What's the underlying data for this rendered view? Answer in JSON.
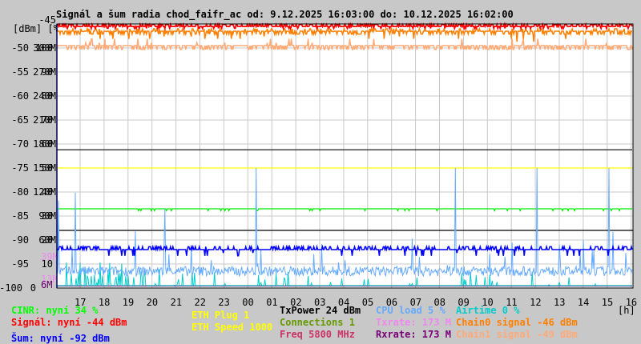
{
  "chart_data": {
    "type": "line",
    "title": "Signál a šum radia chod_faifr_ac od: 9.12.2025 16:03:00 do: 10.12.2025 16:02:00",
    "ylabel": "[dBm] [%]",
    "xlabel": "[h]",
    "ylim": [
      -100,
      -45
    ],
    "y_ticks": [
      {
        "dbm": "-45",
        "pct": "",
        "rate": ""
      },
      {
        "dbm": "-50",
        "pct": "100",
        "rate": "300M"
      },
      {
        "dbm": "-55",
        "pct": "90",
        "rate": "270M"
      },
      {
        "dbm": "-60",
        "pct": "80",
        "rate": "240M"
      },
      {
        "dbm": "-65",
        "pct": "70",
        "rate": "210M"
      },
      {
        "dbm": "-70",
        "pct": "60",
        "rate": "180M"
      },
      {
        "dbm": "-75",
        "pct": "50",
        "rate": "150M"
      },
      {
        "dbm": "-80",
        "pct": "40",
        "rate": "120M"
      },
      {
        "dbm": "-85",
        "pct": "30",
        "rate": "90M"
      },
      {
        "dbm": "-90",
        "pct": "20",
        "rate": "60M"
      },
      {
        "dbm": "-95",
        "pct": "10",
        "rate": ""
      },
      {
        "dbm": "-100",
        "pct": "0",
        "rate": ""
      }
    ],
    "rate_markers": {
      "txrate": "39M",
      "txrate2": "13M",
      "rxrate": "6M"
    },
    "x_ticks": [
      "17",
      "18",
      "19",
      "20",
      "21",
      "22",
      "23",
      "00",
      "01",
      "02",
      "03",
      "04",
      "05",
      "06",
      "07",
      "08",
      "09",
      "10",
      "11",
      "12",
      "13",
      "14",
      "15",
      "16"
    ],
    "grid": true,
    "series": [
      {
        "name": "Signál",
        "color": "#ff0000",
        "level": -45.5
      },
      {
        "name": "Chain0 signal",
        "color": "#ff8000",
        "level": -46.5
      },
      {
        "name": "Chain1 signal",
        "color": "#ffaa77",
        "level": -49.5
      },
      {
        "name": "Šum",
        "color": "#0000ff",
        "level": -92
      },
      {
        "name": "CPU load",
        "color": "#66aaff",
        "level": -96.5
      },
      {
        "name": "Airtime",
        "color": "#00cccc",
        "level": -99.5
      },
      {
        "name": "Connections",
        "color": "#00ee00",
        "level": -83.5
      },
      {
        "name": "ETH Speed",
        "color": "#ffff00",
        "level": -75
      },
      {
        "name": "TxPower",
        "color": "#000000",
        "level": -71.2
      },
      {
        "name": "Rxrate",
        "color": "#660066",
        "level": -99.6
      }
    ]
  },
  "legend": {
    "cinr": "CINR: nyní 34 %",
    "signal": "Signál: nyní -44 dBm",
    "noise": "Šum: nyní -92 dBm",
    "eth_plug": "ETH Plug 1",
    "eth_speed": "ETH Speed 1000",
    "txpower": "TxPower 24 dBm",
    "connections": "Connections 1",
    "freq": "Freq 5800 MHz",
    "cpu": "CPU load 5 %",
    "txrate": "Txrate: 173 M",
    "rxrate": "Rxrate: 173 M",
    "airtime": "Airtime 0 %",
    "chain0": "Chain0 signal -46 dBm",
    "chain1": "Chain1 signal -49 dBm"
  }
}
